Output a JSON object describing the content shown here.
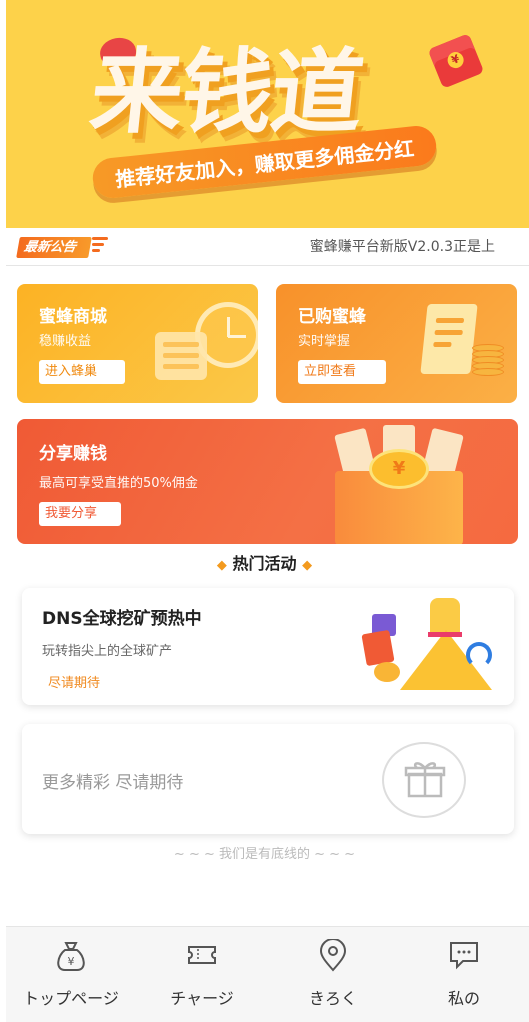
{
  "banner": {
    "title": "来钱道",
    "slogan": "推荐好友加入，赚取更多佣金分红"
  },
  "notice": {
    "tag": "最新公告",
    "text": "蜜蜂赚平台新版V2.0.3正是上"
  },
  "cards": {
    "mall": {
      "title": "蜜蜂商城",
      "subtitle": "稳赚收益",
      "button": "进入蜂巢"
    },
    "bought": {
      "title": "已购蜜蜂",
      "subtitle": "实时掌握",
      "button": "立即查看"
    },
    "share": {
      "title": "分享赚钱",
      "subtitle": "最高可享受直推的50%佣金",
      "button": "我要分享"
    }
  },
  "hot": {
    "title": "热门活动",
    "activity": {
      "title": "DNS全球挖矿预热中",
      "subtitle": "玩转指尖上的全球矿产",
      "status": "尽请期待"
    },
    "more": "更多精彩 尽请期待"
  },
  "footer_text": "~ ~ ~ 我们是有底线的 ~ ~ ~",
  "tabbar": [
    {
      "label": "トップページ",
      "icon": "money-bag-icon"
    },
    {
      "label": "チャージ",
      "icon": "ticket-icon"
    },
    {
      "label": "きろく",
      "icon": "location-pin-icon"
    },
    {
      "label": "私の",
      "icon": "chat-icon"
    }
  ],
  "colors": {
    "banner_bg": "#fdd24a",
    "mall_card": "#fcb224",
    "bought_card": "#f8912a",
    "share_card": "#f05a35",
    "accent": "#f08a20"
  }
}
